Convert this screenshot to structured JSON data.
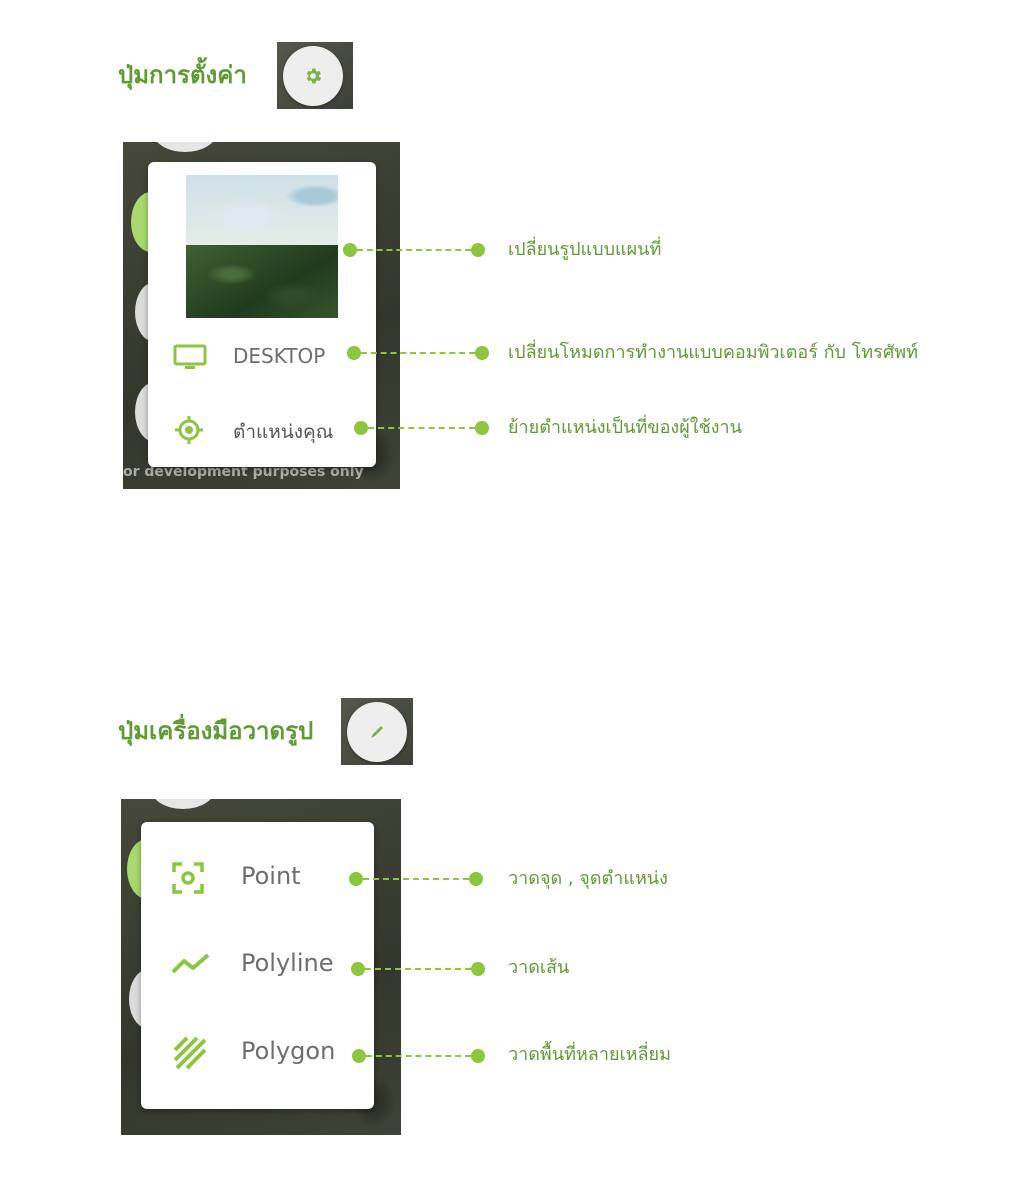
{
  "settings_section": {
    "heading": "ปุ่มการตั้งค่า",
    "button_icon": "gear-icon",
    "menu": {
      "desktop_label": "DESKTOP",
      "location_label": "ตำแหน่งคุณ",
      "footer_text": "or development purposes only"
    },
    "callouts": [
      "เปลี่ยนรูปแบบแผนที่",
      "เปลี่ยนโหมดการทำงานแบบคอมพิวเตอร์ กับ โทรศัพท์",
      "ย้ายตำแหน่งเป็นที่ของผู้ใช้งาน"
    ]
  },
  "draw_section": {
    "heading": "ปุ่มเครื่องมือวาดรูป",
    "button_icon": "pencil-icon",
    "menu": {
      "point_label": "Point",
      "polyline_label": "Polyline",
      "polygon_label": "Polygon"
    },
    "callouts": [
      "วาดจุด , จุดตำแหน่ง",
      "วาดเส้น",
      "วาดพื้นที่หลายเหลี่ยม"
    ]
  },
  "colors": {
    "accent_green": "#8cc63f",
    "heading_green": "#5f9a33"
  }
}
